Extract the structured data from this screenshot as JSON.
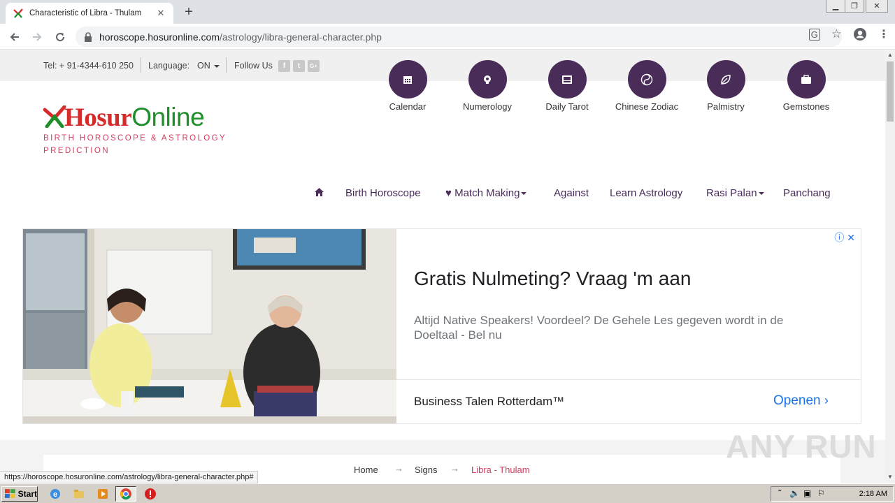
{
  "browser": {
    "tab_title": "Characteristic of Libra - Thulam",
    "url_host": "horoscope.hosuronline.com",
    "url_path": "/astrology/libra-general-character.php",
    "status_url": "https://horoscope.hosuronline.com/astrology/libra-general-character.php#"
  },
  "topbar": {
    "tel": "Tel: + 91-4344-610 250",
    "language_label": "Language:",
    "language_value": "ON",
    "follow_label": "Follow Us",
    "social": [
      "f",
      "t",
      "G+"
    ]
  },
  "quicklinks": [
    {
      "label": "Calendar",
      "icon": "calendar-icon"
    },
    {
      "label": "Numerology",
      "icon": "numerology-icon"
    },
    {
      "label": "Daily Tarot",
      "icon": "tarot-icon"
    },
    {
      "label": "Chinese Zodiac",
      "icon": "yin-yang-icon"
    },
    {
      "label": "Palmistry",
      "icon": "leaf-icon"
    },
    {
      "label": "Gemstones",
      "icon": "gem-case-icon"
    }
  ],
  "logo": {
    "part1": "Hosur",
    "part2": "Online",
    "tagline1": "BIRTH HOROSCOPE & ASTROLOGY",
    "tagline2": "PREDICTION"
  },
  "nav": {
    "birth_horoscope": "Birth Horoscope",
    "match_making": "Match Making",
    "against": "Against",
    "learn_astrology": "Learn Astrology",
    "rasi_palan": "Rasi Palan",
    "panchang": "Panchang"
  },
  "ad": {
    "headline": "Gratis Nulmeting? Vraag 'm aan",
    "description": "Altijd Native Speakers! Voordeel? De Gehele Les gegeven wordt in de Doeltaal - Bel nu",
    "brand": "Business Talen Rotterdam™",
    "cta": "Openen"
  },
  "breadcrumb": {
    "home": "Home",
    "signs": "Signs",
    "current": "Libra - Thulam",
    "arrow": "→"
  },
  "watermark": "ANY RUN",
  "taskbar": {
    "start": "Start",
    "clock": "2:18 AM"
  },
  "colors": {
    "brand_purple": "#4a2c59",
    "logo_red": "#d62b2b",
    "logo_green": "#1f8f2a",
    "accent_pink": "#d04060",
    "link_blue": "#1a73e8"
  }
}
